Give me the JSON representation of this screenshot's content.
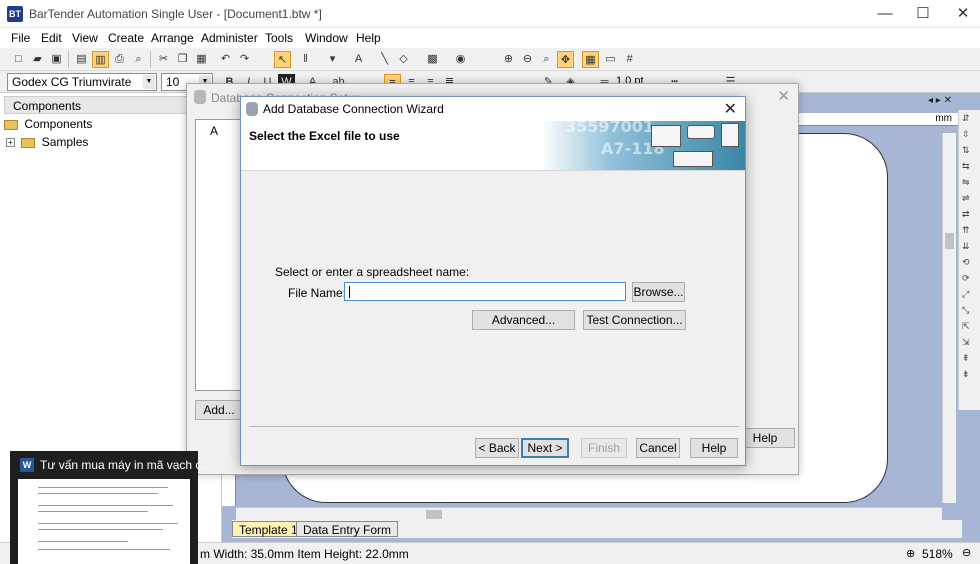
{
  "window": {
    "title": "BarTender Automation Single User - [Document1.btw *]",
    "icon": "BT",
    "minimize": "—",
    "maximize": "☐",
    "close": "✕"
  },
  "menu": [
    "File",
    "Edit",
    "View",
    "Create",
    "Arrange",
    "Administer",
    "Tools",
    "Window",
    "Help"
  ],
  "toolbar": {
    "font": "Godex CG Triumvirate",
    "size": "10",
    "line_width": "1.0 pt"
  },
  "components": {
    "header": "Components",
    "tree": [
      "Components",
      "Samples"
    ]
  },
  "ruler": {
    "unit": "mm"
  },
  "tabs": [
    "Template 1",
    "Data Entry Form"
  ],
  "status": {
    "item_size": "m Width: 35.0mm  Item Height: 22.0mm",
    "zoom": "518%"
  },
  "db_setup": {
    "title": "Database Connection Setup",
    "add_button": "Add...",
    "help_button": "Help",
    "list_item": "A"
  },
  "wizard": {
    "title": "Add Database Connection Wizard",
    "heading": "Select the Excel file to use",
    "banner_numbers": [
      "35597001",
      "A7-118"
    ],
    "prompt": "Select or enter a spreadsheet name:",
    "file_label": "File Name:",
    "file_value": "",
    "buttons": {
      "browse": "Browse...",
      "advanced": "Advanced...",
      "test": "Test Connection...",
      "back": "< Back",
      "next": "Next >",
      "finish": "Finish",
      "cancel": "Cancel",
      "help": "Help"
    }
  },
  "taskbar_preview": {
    "title": "Tư vấn mua máy in mã vạch c...",
    "app_icon": "W"
  }
}
